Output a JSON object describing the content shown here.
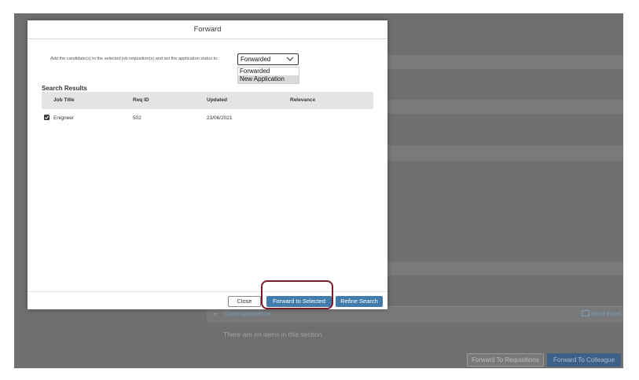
{
  "dialog": {
    "title": "Forward",
    "instruction": "Add the candidate(s) to the selected job requisition(s) and set the application status to:",
    "status_select": {
      "value": "Forwarded",
      "options": [
        "Forwarded",
        "New Application"
      ]
    },
    "results_title": "Search Results",
    "table": {
      "columns": [
        "Job Title",
        "Req ID",
        "Updated",
        "Relevance"
      ],
      "rows": [
        {
          "checked": true,
          "job_title": "Enigneer",
          "req_id": "502",
          "updated": "23/06/2021",
          "relevance": ""
        }
      ]
    },
    "footer": {
      "close_label": "Close",
      "forward_selected_label": "Forward to Selected",
      "refine_label": "Refine Search"
    }
  },
  "background": {
    "section_title": "Correspondence",
    "send_email_label": "Send Email",
    "empty_text": "There are no items in this section.",
    "forward_requisitions_label": "Forward To Requisitions",
    "forward_colleague_label": "Forward To Colleague"
  },
  "colors": {
    "primary_button": "#427cac",
    "highlight": "#7b1b2a",
    "backdrop": "#6f6f6f"
  },
  "icons": [
    "chevron-down-icon",
    "checkbox-checked-icon",
    "mail-icon",
    "chevron-icon"
  ]
}
